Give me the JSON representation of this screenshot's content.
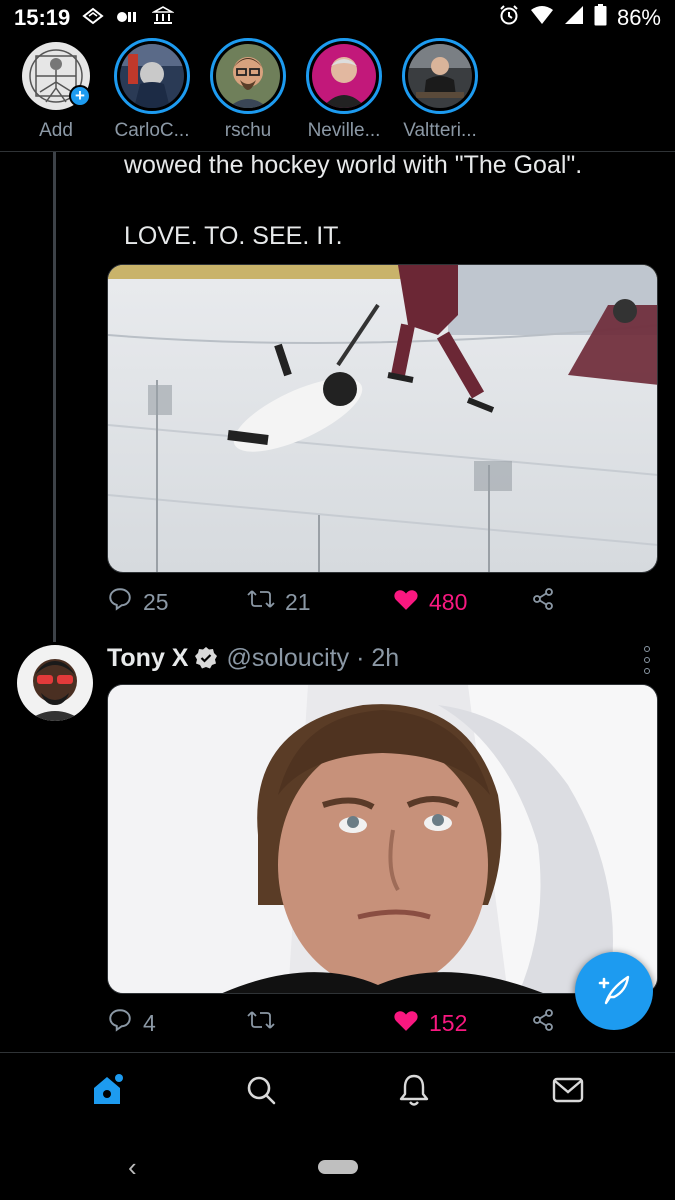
{
  "status_bar": {
    "time": "15:19",
    "battery": "86%"
  },
  "fleets": [
    {
      "label": "Add",
      "is_add": true
    },
    {
      "label": "CarloC..."
    },
    {
      "label": "rschu"
    },
    {
      "label": "Neville..."
    },
    {
      "label": "Valtteri..."
    }
  ],
  "tweet1": {
    "text_line1": "wowed the hockey world with \"The Goal\".",
    "text_line2": "LOVE. TO. SEE. IT.",
    "replies": "25",
    "retweets": "21",
    "likes": "480"
  },
  "tweet2": {
    "name": "Tony X",
    "handle_time": "@soloucity · 2h",
    "replies": "4",
    "retweets": "",
    "likes": "152"
  },
  "colors": {
    "accent": "#1d9bf0",
    "like": "#f91880",
    "muted": "#8b98a5"
  }
}
